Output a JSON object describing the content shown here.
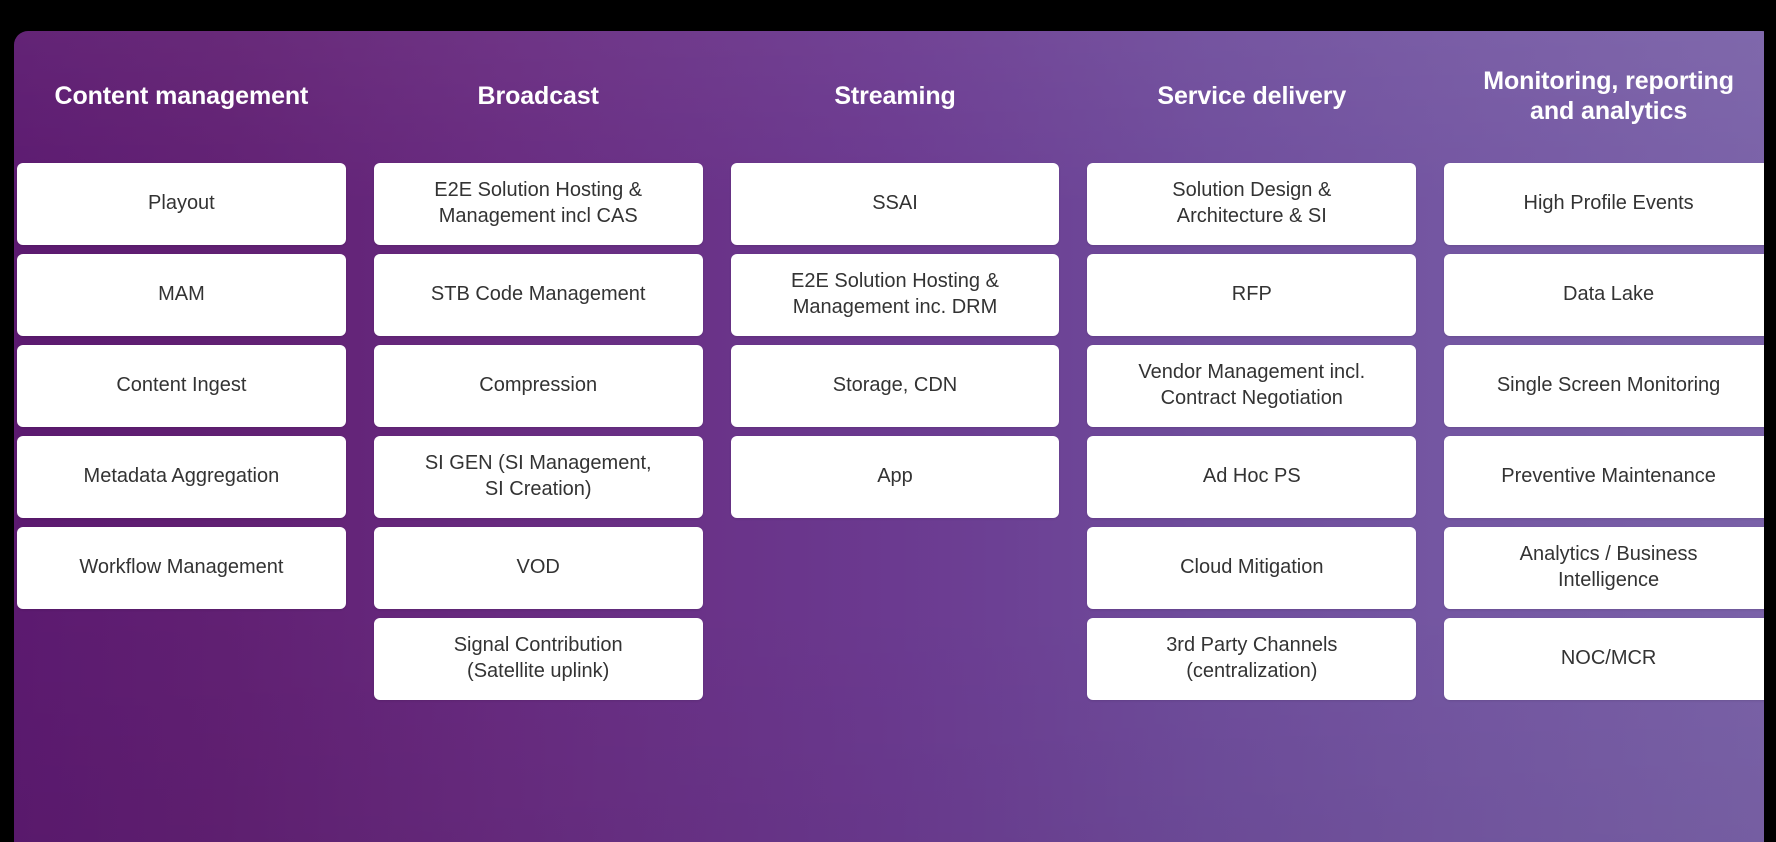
{
  "panel": {
    "gradient_start": "#5c1a70",
    "gradient_mid": "#6b3a90",
    "gradient_end": "#7a62a8",
    "card_background": "#ffffff",
    "card_text_color": "#333333",
    "header_text_color": "#ffffff",
    "page_background": "#000000"
  },
  "columns": [
    {
      "id": "content-management",
      "title": "Content management",
      "cards": [
        {
          "label": "Playout"
        },
        {
          "label": "MAM"
        },
        {
          "label": "Content Ingest"
        },
        {
          "label": "Metadata Aggregation"
        },
        {
          "label": "Workflow Management"
        }
      ]
    },
    {
      "id": "broadcast",
      "title": "Broadcast",
      "cards": [
        {
          "label": "E2E Solution Hosting &\nManagement incl CAS"
        },
        {
          "label": "STB Code Management"
        },
        {
          "label": "Compression"
        },
        {
          "label": "SI GEN (SI Management,\nSI Creation)"
        },
        {
          "label": "VOD"
        },
        {
          "label": "Signal Contribution\n(Satellite uplink)"
        }
      ]
    },
    {
      "id": "streaming",
      "title": "Streaming",
      "cards": [
        {
          "label": "SSAI"
        },
        {
          "label": "E2E Solution Hosting &\nManagement inc. DRM"
        },
        {
          "label": "Storage, CDN"
        },
        {
          "label": "App"
        }
      ]
    },
    {
      "id": "service-delivery",
      "title": "Service delivery",
      "cards": [
        {
          "label": "Solution Design &\nArchitecture & SI"
        },
        {
          "label": "RFP"
        },
        {
          "label": "Vendor Management incl.\nContract Negotiation"
        },
        {
          "label": "Ad Hoc PS"
        },
        {
          "label": "Cloud Mitigation"
        },
        {
          "label": "3rd Party Channels\n(centralization)"
        }
      ]
    },
    {
      "id": "monitoring-reporting-analytics",
      "title": "Monitoring, reporting\nand analytics",
      "cards": [
        {
          "label": "High Profile Events"
        },
        {
          "label": "Data Lake"
        },
        {
          "label": "Single Screen Monitoring"
        },
        {
          "label": "Preventive Maintenance"
        },
        {
          "label": "Analytics / Business\nIntelligence"
        },
        {
          "label": "NOC/MCR"
        }
      ]
    }
  ]
}
